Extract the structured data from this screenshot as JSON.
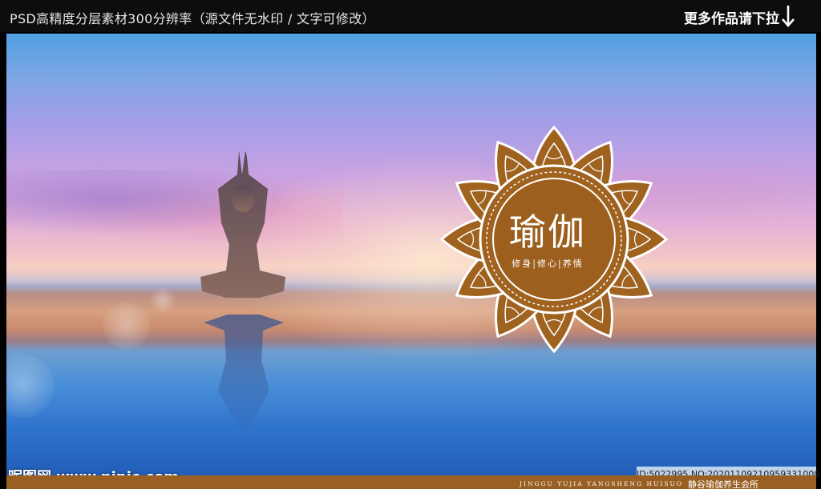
{
  "header": {
    "title": "PSD高精度分层素材300分辨率（源文件无水印 / 文字可修改）",
    "more_link": "更多作品请下拉",
    "arrow_icon": "arrow-down-icon"
  },
  "poster": {
    "emblem_title": "瑜伽",
    "emblem_subtitle": "修身|修心|养情",
    "brand_color": "#9a5f22",
    "footer_english": "JINGGU YUJIA YANGSHENG HUISUO",
    "footer_chinese": "静谷瑜伽养生会所"
  },
  "watermark": {
    "site": "昵图网 www.nipic.com",
    "id_text": "ID:5022995 NO:20201109210959331000"
  }
}
